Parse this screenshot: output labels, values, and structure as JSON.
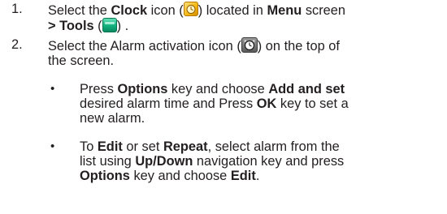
{
  "steps": [
    {
      "number": "1.",
      "text_a": "Select the ",
      "bold_a": "Clock",
      "text_b": " icon (",
      "text_c": ") located in ",
      "bold_b": "Menu",
      "text_d": " screen",
      "bold_c": "> Tools",
      "text_e": " (",
      "text_f": ") ."
    },
    {
      "number": "2.",
      "text_a": "Select the Alarm activation icon (",
      "text_b": ") on the top of",
      "line2": "the screen."
    }
  ],
  "bullets": [
    {
      "dot": "•",
      "text_a": "Press ",
      "bold_a": "Options",
      "text_b": " key and choose ",
      "bold_b": "Add and set",
      "line2": "desired alarm time and Press ",
      "bold_c": "OK",
      "text_c": " key to set a",
      "line3": "new alarm."
    },
    {
      "dot": "•",
      "text_a": "To ",
      "bold_a": "Edit",
      "text_b": " or set ",
      "bold_b": "Repeat",
      "text_c": ", select alarm from the",
      "line2": "list using ",
      "bold_c": "Up/Down",
      "text_d": " navigation key and press",
      "bold_d": "Options",
      "text_e": " key and choose ",
      "bold_e": "Edit",
      "text_f": "."
    }
  ],
  "icons": {
    "clock": "clock-icon",
    "tools": "tools-icon",
    "alarm": "alarm-activation-icon"
  },
  "colors": {
    "text": "#231f20",
    "clock_icon": "#f3b510",
    "tools_icon": "#14b07e",
    "alarm_icon": "#5b5b5b"
  }
}
